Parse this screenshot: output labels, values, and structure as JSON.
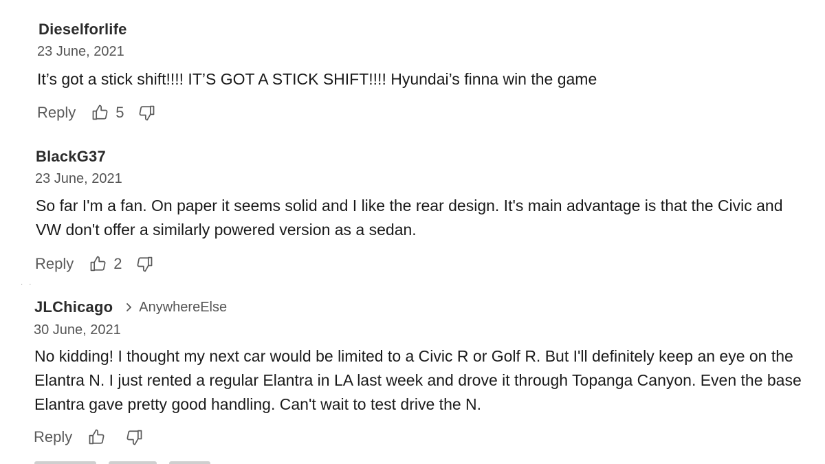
{
  "comments": [
    {
      "author": "Dieselforlife",
      "date": "23 June, 2021",
      "body": "It’s got a stick shift!!!! IT’S GOT A STICK SHIFT!!!! Hyundai’s finna win the game",
      "reply_label": "Reply",
      "upvotes": "5"
    },
    {
      "author": "BlackG37",
      "date": "23 June, 2021",
      "body": "So far I'm a fan. On paper it seems solid and I like the rear design. It's main advantage is that the Civic and VW don't offer a similarly powered version as a sedan.",
      "reply_label": "Reply",
      "upvotes": "2"
    },
    {
      "author": "JLChicago",
      "reply_to": "AnywhereElse",
      "date": "30 June, 2021",
      "body": "No kidding!   I thought my next car would be limited to a Civic R or Golf R.  But I'll definitely keep an eye on the Elantra N.   I just rented a regular Elantra in LA last week and drove it through Topanga Canyon.   Even the base Elantra gave pretty good handling.  Can't wait to test drive the N.",
      "reply_label": "Reply",
      "upvotes": ""
    }
  ],
  "icons": {
    "thumbs_up": "thumbs-up-icon",
    "thumbs_down": "thumbs-down-icon",
    "reply_to": "chevron-right-icon"
  },
  "colors": {
    "text": "#1a1a1a",
    "muted": "#555555",
    "icon": "#5a5a5a"
  }
}
